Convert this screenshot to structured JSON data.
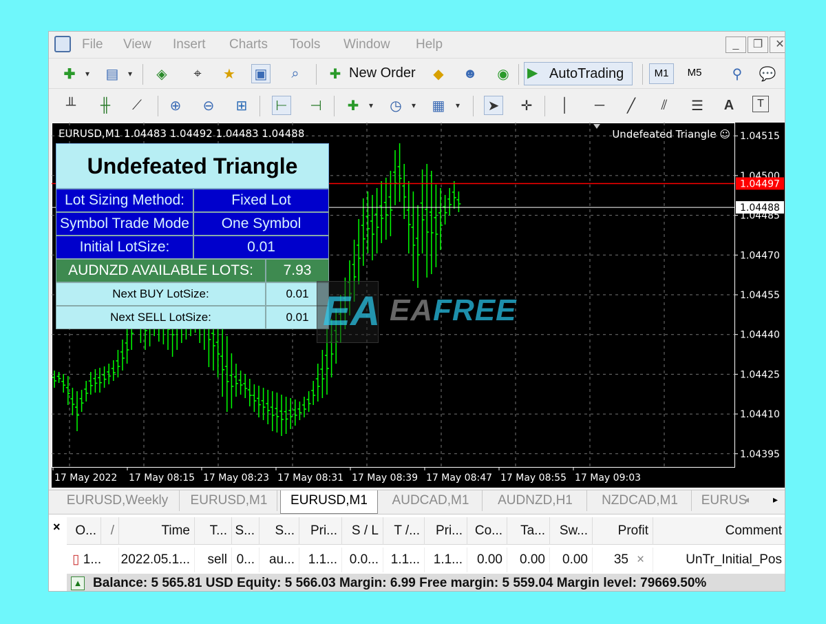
{
  "menu": {
    "items": [
      "File",
      "View",
      "Insert",
      "Charts",
      "Tools",
      "Window",
      "Help"
    ]
  },
  "window_controls": [
    "_",
    "❐",
    "✕"
  ],
  "toolbar": {
    "new_order_label": "New Order",
    "autotrading_label": "AutoTrading",
    "timeframes": [
      "M1",
      "M5"
    ]
  },
  "chart": {
    "title_line": "EURUSD,M1  1.04483 1.04492 1.04483 1.04488",
    "ea_name": "Undefeated Triangle",
    "price_ticks": [
      "1.04515",
      "1.04500",
      "1.04485",
      "1.04470",
      "1.04455",
      "1.04440",
      "1.04425",
      "1.04410",
      "1.04395"
    ],
    "time_ticks": [
      "17 May 2022",
      "17 May 08:15",
      "17 May 08:23",
      "17 May 08:31",
      "17 May 08:39",
      "17 May 08:47",
      "17 May 08:55",
      "17 May 09:03"
    ],
    "ask_label": "1.04497",
    "bid_label": "1.04488",
    "ask_line_color": "#ff0000",
    "bid_line_color": "#ffffff",
    "bar_color": "#00ff00"
  },
  "panel": {
    "title": "Undefeated Triangle",
    "rows": [
      {
        "label": "Lot Sizing Method:",
        "value": "Fixed Lot"
      },
      {
        "label": "Symbol Trade Mode",
        "value": "One Symbol"
      },
      {
        "label": "Initial LotSize:",
        "value": "0.01"
      }
    ],
    "available": {
      "label": "AUDNZD AVAILABLE LOTS:",
      "value": "7.93"
    },
    "next_buy": {
      "label": "Next BUY LotSize:",
      "value": "0.01"
    },
    "next_sell": {
      "label": "Next SELL LotSize:",
      "value": "0.01"
    }
  },
  "watermark": {
    "logo": "EA",
    "brand_ea": "EA",
    "brand_free": "FREE"
  },
  "tabs": [
    "EURUSD,Weekly",
    "EURUSD,M1",
    "EURUSD,M1",
    "AUDCAD,M1",
    "AUDNZD,H1",
    "NZDCAD,M1",
    "EURUS"
  ],
  "active_tab_index": 2,
  "terminal": {
    "close": "×",
    "headers": [
      "O...",
      "/",
      "Time",
      "T...",
      "S...",
      "S...",
      "Pri...",
      "S / L",
      "T /...",
      "Pri...",
      "Co...",
      "Ta...",
      "Sw...",
      "Profit",
      "",
      "Comment"
    ],
    "row": [
      "1...",
      "2022.05.1...",
      "sell",
      "0...",
      "au...",
      "1.1...",
      "0.0...",
      "1.1...",
      "1.1...",
      "0.00",
      "0.00",
      "0.00",
      "35",
      "×",
      "UnTr_Initial_Pos"
    ],
    "status": "Balance: 5 565.81 USD  Equity: 5 566.03  Margin: 6.99  Free margin: 5 559.04  Margin level: 79669.50%"
  }
}
